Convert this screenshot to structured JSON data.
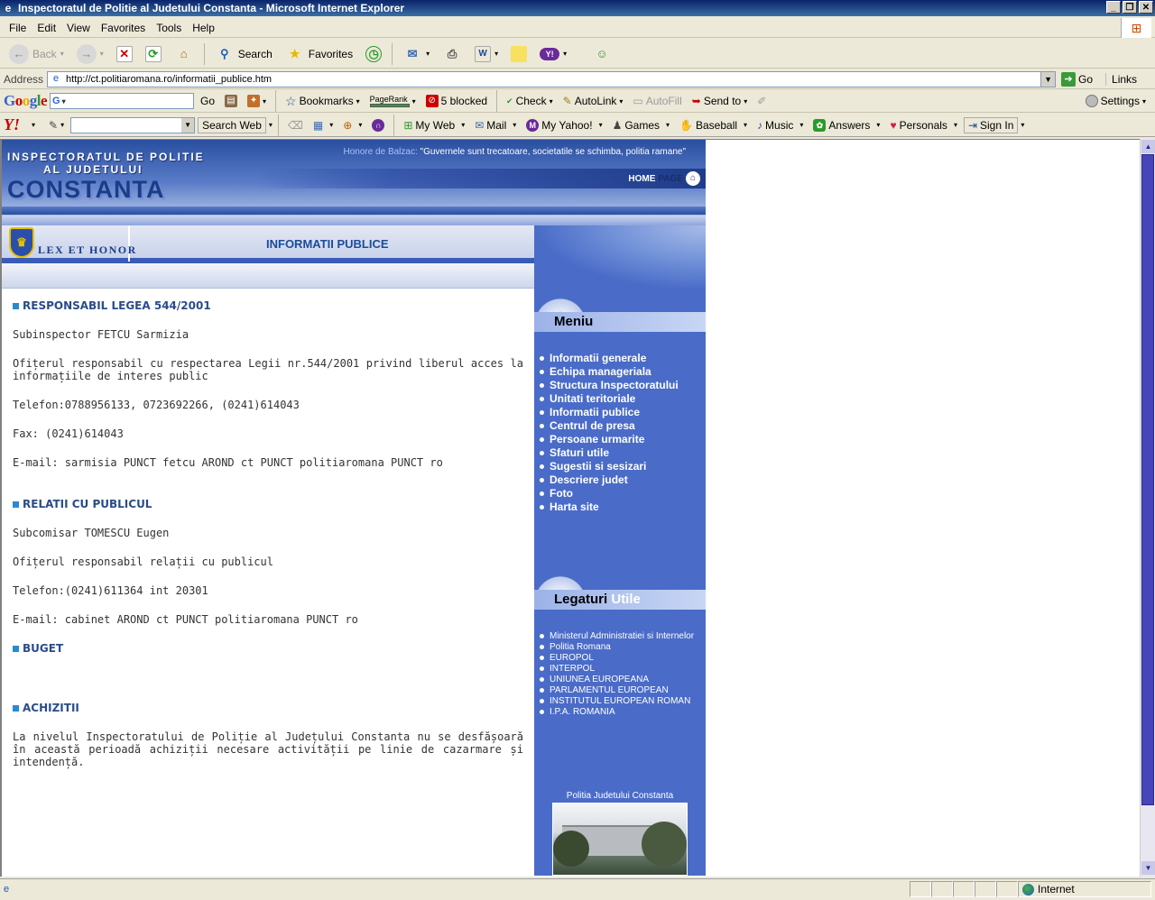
{
  "window": {
    "title": "Inspectoratul de Politie al Judetului Constanta - Microsoft Internet Explorer"
  },
  "menubar": [
    "File",
    "Edit",
    "View",
    "Favorites",
    "Tools",
    "Help"
  ],
  "toolbar": {
    "back": "Back",
    "search": "Search",
    "favorites": "Favorites"
  },
  "address": {
    "label": "Address",
    "url": "http://ct.politiaromana.ro/informatii_publice.htm",
    "go": "Go",
    "links": "Links"
  },
  "googlebar": {
    "logo": [
      "G",
      "o",
      "o",
      "g",
      "l",
      "e"
    ],
    "input_prefix": "G",
    "go": "Go",
    "bookmarks": "Bookmarks",
    "pagerank": "PageRank",
    "blocked": "5 blocked",
    "check": "Check",
    "autolink": "AutoLink",
    "autofill": "AutoFill",
    "sendto": "Send to",
    "settings": "Settings"
  },
  "yahoobar": {
    "logo": "Y!",
    "search_web": "Search Web",
    "my_web": "My Web",
    "mail": "Mail",
    "my_yahoo": "My Yahoo!",
    "games": "Games",
    "baseball": "Baseball",
    "music": "Music",
    "answers": "Answers",
    "personals": "Personals",
    "sign_in": "Sign In"
  },
  "site": {
    "header": {
      "line1": "INSPECTORATUL DE POLITIE",
      "line2": "AL JUDETULUI",
      "name": "CONSTANTA",
      "quote_author": "Honore de Balzac:",
      "quote": "\"Guvernele sunt trecatoare, societatile se schimba, politia ramane\"",
      "home1": "HOME",
      "home2": "PAGE"
    },
    "motto": "LEX ET HONOR",
    "page_title": "INFORMATII PUBLICE",
    "sections": [
      {
        "title": "RESPONSABIL LEGEA 544/2001",
        "paras": [
          "Subinspector FETCU Sarmizia",
          "Ofițerul responsabil cu respectarea Legii nr.544/2001 privind liberul acces la informațiile de interes public",
          "Telefon:0788956133, 0723692266, (0241)614043",
          "Fax: (0241)614043",
          "E-mail: sarmisia PUNCT fetcu AROND ct PUNCT politiaromana PUNCT ro"
        ]
      },
      {
        "title": "RELATII CU PUBLICUL",
        "paras": [
          "Subcomisar TOMESCU Eugen",
          "Ofițerul responsabil relații cu publicul",
          "Telefon:(0241)611364 int 20301",
          "E-mail: cabinet AROND ct PUNCT politiaromana PUNCT ro"
        ]
      },
      {
        "title": "BUGET",
        "paras": []
      },
      {
        "title": "ACHIZITII",
        "paras": [
          "La nivelul Inspectoratului de Poliție al Județului Constanta nu se desfășoară în această perioadă achiziții necesare activității pe linie de cazarmare și intendență."
        ]
      }
    ],
    "menu": {
      "title": "Meniu",
      "items": [
        "Informatii generale",
        "Echipa manageriala",
        "Structura Inspectoratului",
        "Unitati teritoriale",
        "Informatii publice",
        "Centrul de presa",
        "Persoane urmarite",
        "Sfaturi utile",
        "Sugestii si sesizari",
        "Descriere judet",
        "Foto",
        "Harta site"
      ]
    },
    "links": {
      "title_a": "Legaturi",
      "title_b": "Utile",
      "items": [
        "Ministerul Administratiei si Internelor",
        "Politia Romana",
        "EUROPOL",
        "INTERPOL",
        "UNIUNEA EUROPEANA",
        "PARLAMENTUL EUROPEAN",
        "INSTITUTUL EUROPEAN ROMAN",
        "I.P.A. ROMANIA"
      ]
    },
    "photo_caption": "Politia Judetului Constanta"
  },
  "status": {
    "zone": "Internet"
  }
}
